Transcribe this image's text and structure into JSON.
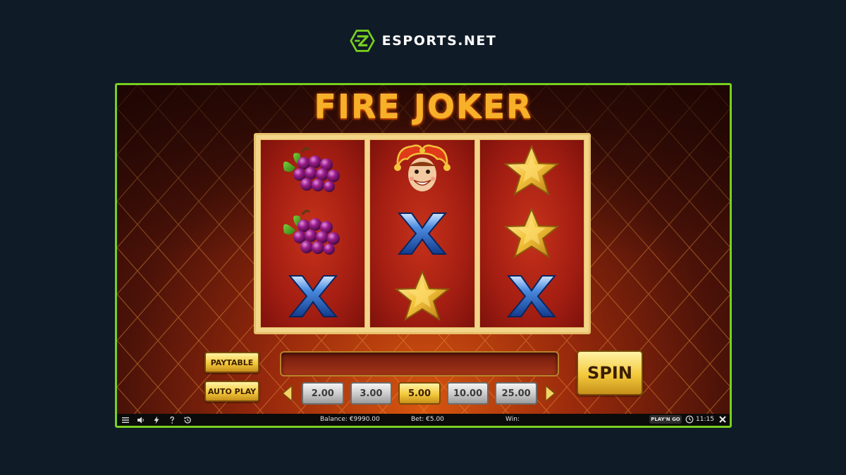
{
  "brand": {
    "name": "ESPORTS.NET",
    "accent": "#78d01e"
  },
  "game": {
    "title": "FIRE JOKER",
    "reels": [
      [
        "grapes-icon",
        "grapes-icon",
        "blue-x-icon"
      ],
      [
        "joker-icon",
        "blue-x-icon",
        "gold-star-icon"
      ],
      [
        "gold-star-icon",
        "gold-star-icon",
        "blue-x-icon"
      ]
    ]
  },
  "controls": {
    "paytable_label": "PAYTABLE",
    "autoplay_label": "AUTO PLAY",
    "spin_label": "SPIN",
    "bet_options": [
      "2.00",
      "3.00",
      "5.00",
      "10.00",
      "25.00"
    ],
    "selected_bet": "5.00"
  },
  "statusbar": {
    "balance": "Balance: €9990.00",
    "bet": "Bet: €5.00",
    "win": "Win:",
    "provider": "PLAY'N GO",
    "time": "11:15",
    "icons": [
      "menu-icon",
      "sound-icon",
      "turbo-icon",
      "help-icon",
      "history-icon",
      "clock-icon",
      "close-icon"
    ]
  }
}
